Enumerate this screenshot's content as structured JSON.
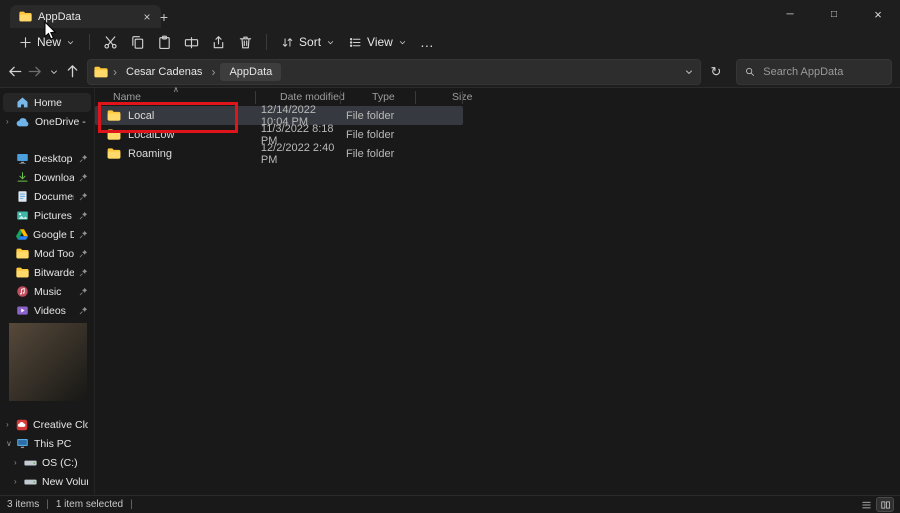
{
  "window": {
    "tab_title": "AppData"
  },
  "glyphs": {
    "new_tab": "+",
    "tab_close": "×",
    "minimize": "─",
    "maximize": "□",
    "close": "×",
    "more": "…",
    "refresh": "↻",
    "sort_caret": "∧",
    "crumb_separator": "›",
    "chevron_collapsed": "›",
    "chevron_expanded": "∨",
    "status_separator": "|"
  },
  "toolbar": {
    "new_label": "New",
    "sort_label": "Sort",
    "view_label": "View"
  },
  "addressbar": {
    "breadcrumbs": [
      "Cesar Cadenas",
      "AppData"
    ],
    "search_placeholder": "Search AppData"
  },
  "sidebar": {
    "items": [
      {
        "label": "Home",
        "icon": "home-icon",
        "pinned": false
      },
      {
        "label": "OneDrive - Pers",
        "icon": "onedrive-icon",
        "pinned": false
      },
      {
        "label": "Desktop",
        "icon": "desktop-icon",
        "pinned": true
      },
      {
        "label": "Downloads",
        "icon": "downloads-icon",
        "pinned": true
      },
      {
        "label": "Documents",
        "icon": "documents-icon",
        "pinned": true
      },
      {
        "label": "Pictures",
        "icon": "pictures-icon",
        "pinned": true
      },
      {
        "label": "Google Drive",
        "icon": "google-drive-icon",
        "pinned": true
      },
      {
        "label": "Mod Tools",
        "icon": "folder-icon",
        "pinned": true
      },
      {
        "label": "Bitwarden ex",
        "icon": "folder-icon",
        "pinned": true
      },
      {
        "label": "Music",
        "icon": "music-icon",
        "pinned": true
      },
      {
        "label": "Videos",
        "icon": "videos-icon",
        "pinned": true
      },
      {
        "label": "Creative Cloud F",
        "icon": "creative-cloud-icon",
        "pinned": false
      },
      {
        "label": "This PC",
        "icon": "this-pc-icon",
        "pinned": false
      },
      {
        "label": "OS (C:)",
        "icon": "drive-icon",
        "pinned": false
      },
      {
        "label": "New Volume (",
        "icon": "drive-icon",
        "pinned": false
      }
    ]
  },
  "file_list": {
    "columns": [
      "Name",
      "Date modified",
      "Type",
      "Size"
    ],
    "rows": [
      {
        "name": "Local",
        "date_modified": "12/14/2022 10:04 PM",
        "type": "File folder",
        "size": "",
        "selected": true
      },
      {
        "name": "LocalLow",
        "date_modified": "11/3/2022 8:18 PM",
        "type": "File folder",
        "size": "",
        "selected": false
      },
      {
        "name": "Roaming",
        "date_modified": "12/2/2022 2:40 PM",
        "type": "File folder",
        "size": "",
        "selected": false
      }
    ]
  },
  "status_bar": {
    "items_text": "3 items",
    "selected_text": "1 item selected"
  },
  "colors": {
    "annotation_red": "#e0151c",
    "selection_row": "#36393f",
    "folder_yellow": "#ffc83d",
    "chrome_bg": "#1e1e1e",
    "content_bg": "#191919"
  }
}
